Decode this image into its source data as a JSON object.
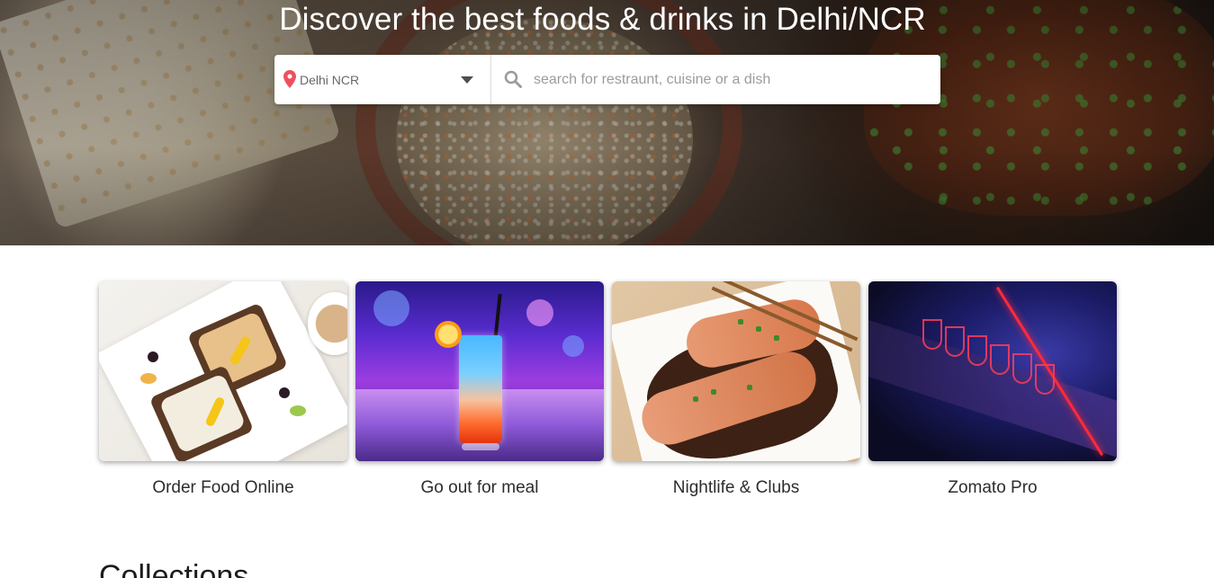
{
  "hero": {
    "title": "Discover the best foods & drinks in Delhi/NCR"
  },
  "search": {
    "location": "Delhi NCR",
    "placeholder": "search for restraunt, cuisine or a dish",
    "value": "",
    "icons": [
      "location-pin-icon",
      "chevron-down-icon",
      "search-icon"
    ],
    "pin_color": "#ef4f5f"
  },
  "categories": [
    {
      "label": "Order Food Online",
      "image": "food-platter-image"
    },
    {
      "label": "Go out for meal",
      "image": "cocktail-image"
    },
    {
      "label": "Nightlife & Clubs",
      "image": "salmon-dish-image"
    },
    {
      "label": "Zomato Pro",
      "image": "bar-glasses-image"
    }
  ],
  "collections": {
    "heading": "Collections"
  }
}
